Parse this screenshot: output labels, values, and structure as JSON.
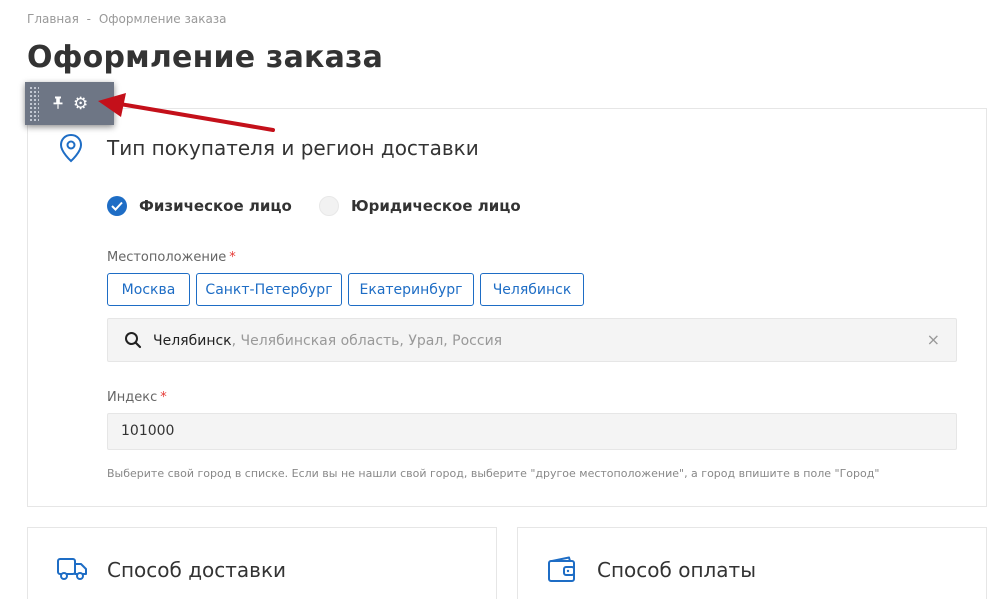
{
  "breadcrumb": {
    "home": "Главная",
    "separator": "-",
    "current": "Оформление заказа"
  },
  "page_title": "Оформление заказа",
  "toolbar": {
    "pin_icon": "pin-icon",
    "settings_icon": "gear-icon"
  },
  "buyer_section": {
    "title": "Тип покупателя и регион доставки",
    "icon": "location-pin-icon",
    "buyer_types": [
      {
        "label": "Физическое лицо",
        "selected": true
      },
      {
        "label": "Юридическое лицо",
        "selected": false
      }
    ],
    "location_label": "Местоположение",
    "required_mark": "*",
    "quick_cities": [
      "Москва",
      "Санкт-Петербург",
      "Екатеринбург",
      "Челябинск"
    ],
    "location_value_city": "Челябинск",
    "location_value_rest": ", Челябинская область, Урал, Россия",
    "clear_symbol": "×",
    "index_label": "Индекс",
    "index_value": "101000",
    "hint": "Выберите свой город в списке. Если вы не нашли свой город, выберите \"другое местоположение\", а город впишите в поле \"Город\""
  },
  "delivery_section": {
    "title": "Способ доставки",
    "icon": "truck-icon"
  },
  "payment_section": {
    "title": "Способ оплаты",
    "icon": "wallet-icon"
  },
  "colors": {
    "accent": "#1e6dc5",
    "required": "#e53935",
    "annotation_arrow": "#c4101a",
    "toolbar_bg": "#6e7685"
  }
}
